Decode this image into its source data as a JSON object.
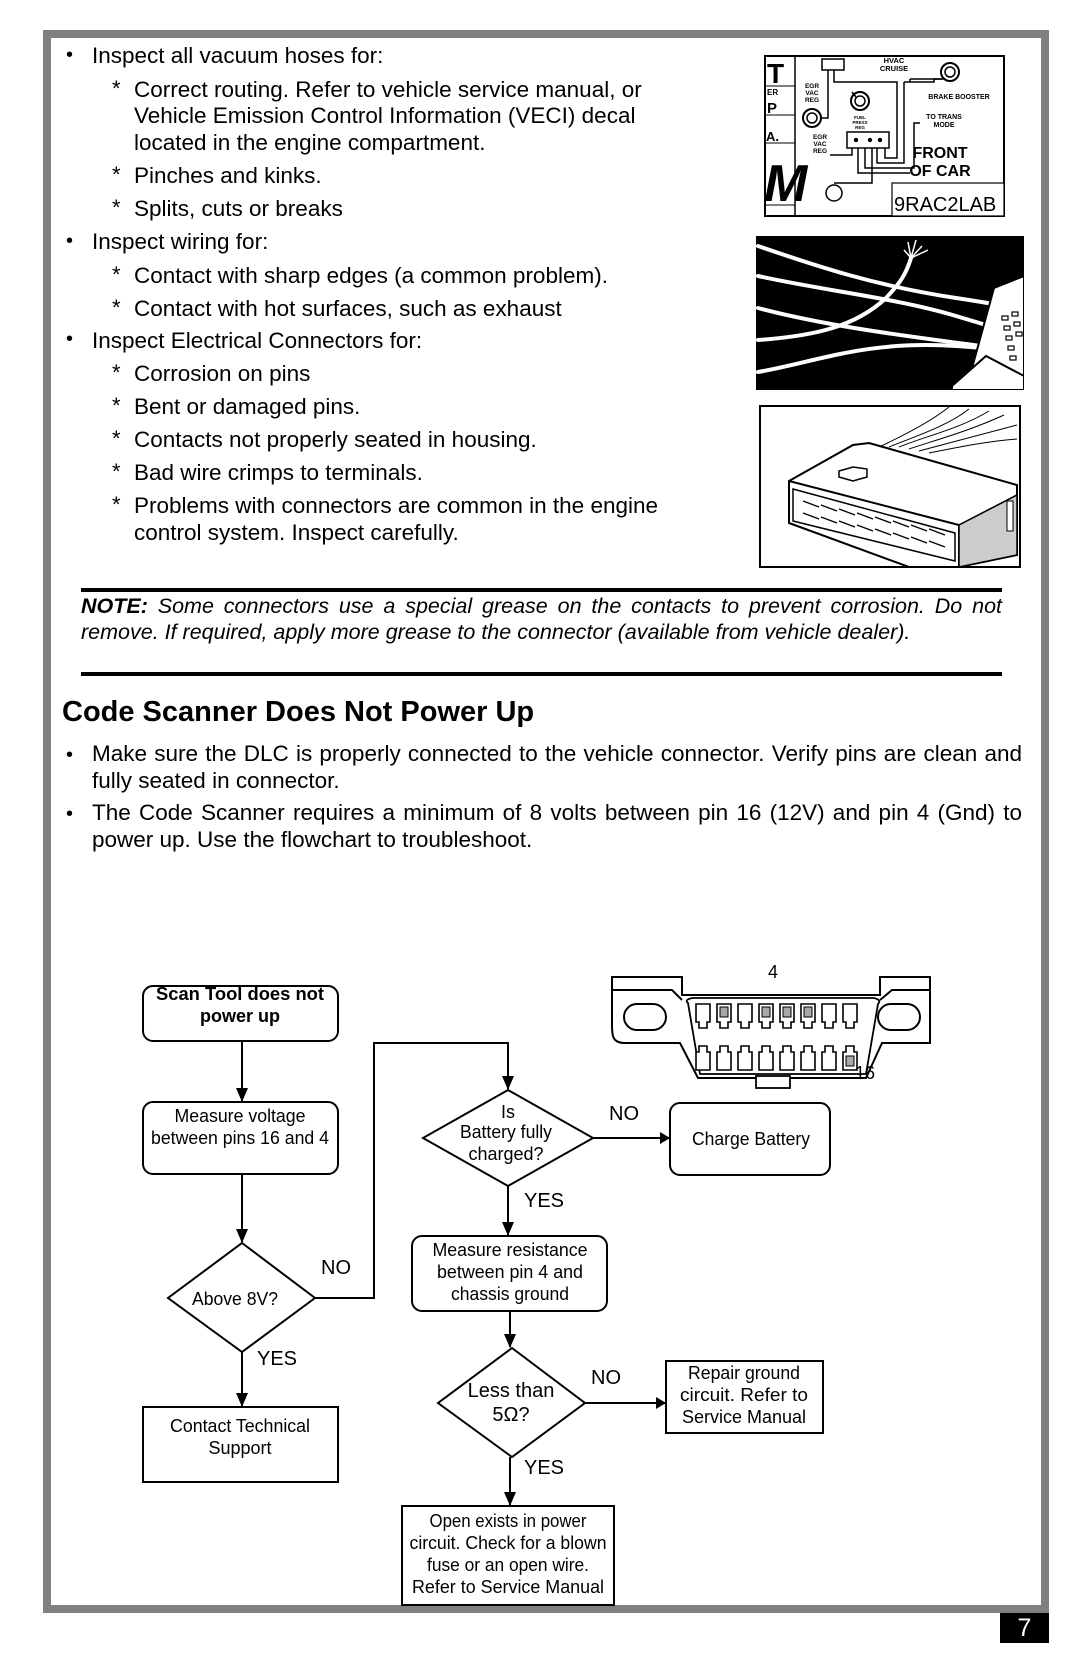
{
  "inspection": {
    "vacuum_hoses": {
      "heading": "Inspect all vacuum hoses for:",
      "items": [
        [
          "Correct routing. Refer to vehicle service manual, or",
          "Vehicle Emission Control Information (VECI) decal",
          "located in the engine compartment."
        ],
        [
          "Pinches and kinks."
        ],
        [
          "Splits, cuts or breaks"
        ]
      ]
    },
    "wiring": {
      "heading": "Inspect wiring for:",
      "items": [
        [
          "Contact with sharp edges (a common problem)."
        ],
        [
          "Contact with hot surfaces, such as exhaust"
        ]
      ]
    },
    "connectors": {
      "heading": "Inspect Electrical Connectors for:",
      "items": [
        [
          "Corrosion on pins"
        ],
        [
          "Bent or damaged pins."
        ],
        [
          "Contacts not properly seated in housing."
        ],
        [
          "Bad wire crimps to terminals."
        ],
        [
          "Problems with connectors are common in the engine",
          "control system. Inspect carefully."
        ]
      ]
    }
  },
  "vacuum_diagram": {
    "left_letters": [
      "T",
      "ER",
      "P",
      "A.",
      "M"
    ],
    "labels": {
      "hvac": "HVAC",
      "cruise": "CRUISE",
      "egr_vac_reg_top": [
        "EGR",
        "VAC",
        "REG"
      ],
      "egr_vac_reg_bottom": [
        "EGR",
        "VAC",
        "REG"
      ],
      "brake_booster": "BRAKE BOOSTER",
      "fuel_press_reg": [
        "FUEL",
        "PRESS",
        "REG"
      ],
      "to_trans": "TO TRANS",
      "mode": "MODE",
      "front": "FRONT",
      "of_car": "OF CAR",
      "code": "9RAC2LAB"
    }
  },
  "note": {
    "label": "NOTE:",
    "text": " Some connectors use a special grease on the contacts to prevent corrosion. Do not remove. If required, apply more grease to the connector (available from vehicle dealer)."
  },
  "section": {
    "title": "Code Scanner Does Not Power Up",
    "bullets": [
      "Make sure the DLC is properly connected to the vehicle connector. Verify pins are clean and fully seated in connector.",
      "The Code Scanner requires a minimum of 8 volts between pin 16 (12V) and pin 4 (Gnd) to power up. Use the flowchart to troubleshoot."
    ]
  },
  "flowchart": {
    "start": [
      "Scan Tool does not",
      "power up"
    ],
    "measure_voltage": [
      "Measure voltage",
      "between pins 16 and 4"
    ],
    "above_8v": [
      "Above 8V?"
    ],
    "contact_support": [
      "Contact Technical",
      "Support"
    ],
    "battery_charged": [
      "Is",
      "Battery fully",
      "charged?"
    ],
    "charge_battery": [
      "Charge Battery"
    ],
    "measure_resistance": [
      "Measure resistance",
      "between pin 4 and",
      "chassis ground"
    ],
    "less_than_5": [
      "Less than",
      "5Ω?"
    ],
    "repair_ground": [
      "Repair ground",
      "circuit.  Refer to",
      "Service Manual"
    ],
    "open_exists": [
      "Open exists in power",
      "circuit. Check for a blown",
      "fuse or an open wire.",
      "Refer to Service Manual"
    ],
    "yes": "YES",
    "no": "NO"
  },
  "dlc": {
    "pin_top_label": "4",
    "pin_bottom_label": "16"
  },
  "page_number": "7"
}
